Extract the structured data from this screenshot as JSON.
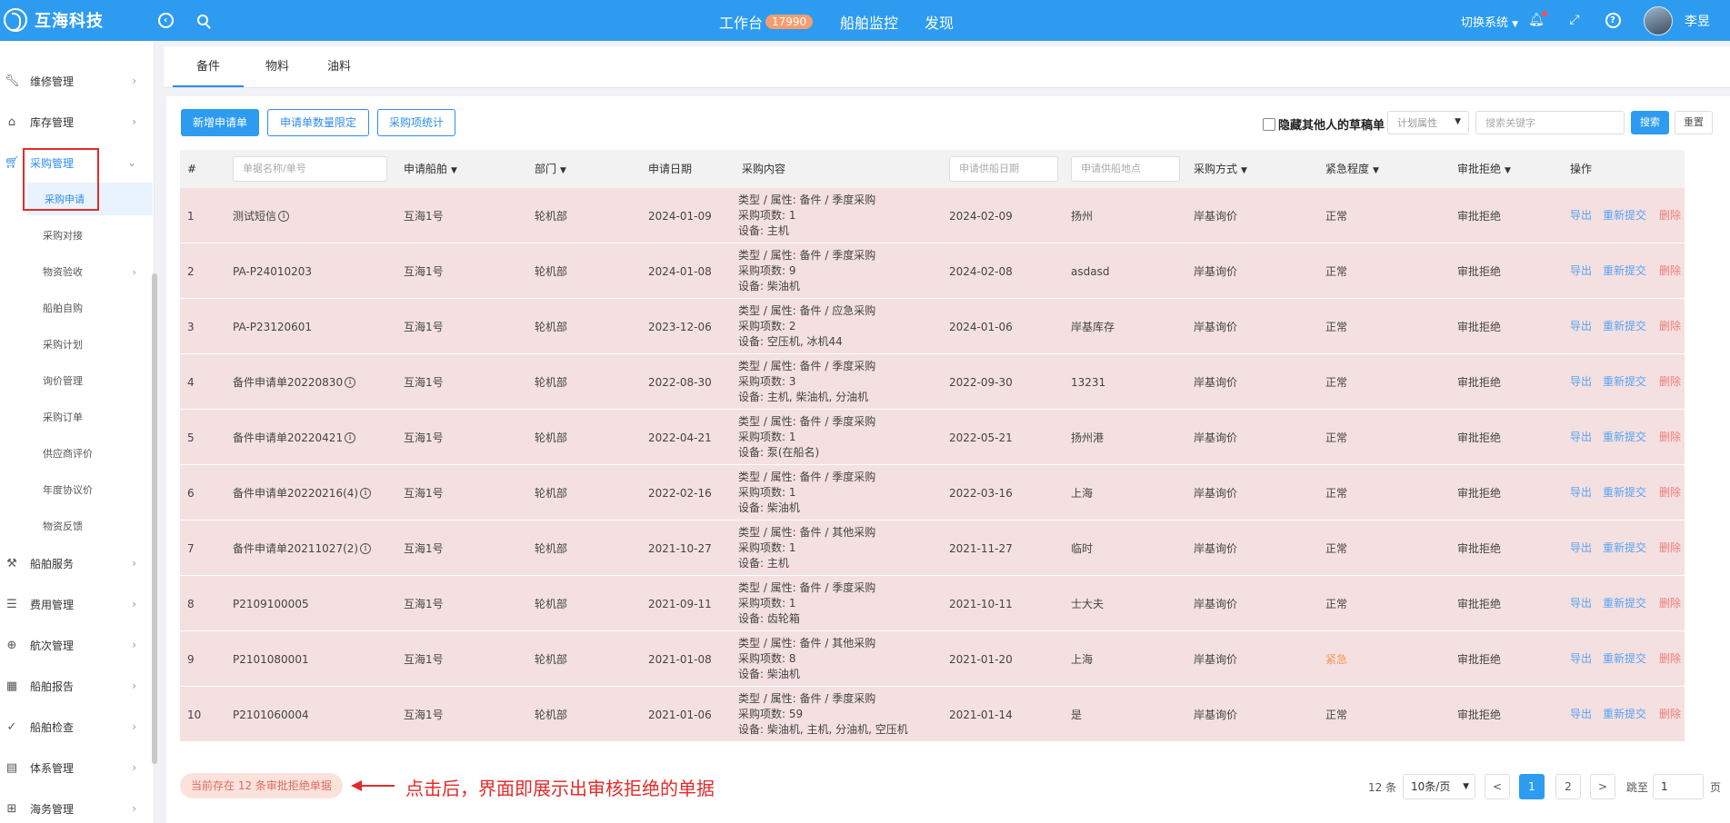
{
  "app": {
    "brand": "互海科技",
    "nav": [
      {
        "label": "工作台",
        "badge": "17990"
      },
      {
        "label": "船舶监控"
      },
      {
        "label": "发现"
      }
    ],
    "switch_system": "切换系统",
    "user": "李昱"
  },
  "sidebar": {
    "items": [
      {
        "label": "维修管理"
      },
      {
        "label": "库存管理"
      },
      {
        "label": "采购管理"
      },
      {
        "label": "船舶服务"
      },
      {
        "label": "费用管理"
      },
      {
        "label": "航次管理"
      },
      {
        "label": "船舶报告"
      },
      {
        "label": "船舶检查"
      },
      {
        "label": "体系管理"
      },
      {
        "label": "海务管理"
      }
    ],
    "sub_items": [
      {
        "label": "采购申请"
      },
      {
        "label": "采购对接"
      },
      {
        "label": "物资验收"
      },
      {
        "label": "船舶自购"
      },
      {
        "label": "采购计划"
      },
      {
        "label": "询价管理"
      },
      {
        "label": "采购订单"
      },
      {
        "label": "供应商评价"
      },
      {
        "label": "年度协议价"
      },
      {
        "label": "物资反馈"
      }
    ]
  },
  "tabs": [
    {
      "label": "备件"
    },
    {
      "label": "物料"
    },
    {
      "label": "油料"
    }
  ],
  "toolbar": {
    "new_button": "新增申请单",
    "limit_button": "申请单数量限定",
    "stats_button": "采购项统计",
    "hide_drafts": "隐藏其他人的草稿单",
    "plan_attr_placeholder": "计划属性",
    "search_placeholder": "搜索关键字",
    "search_button": "搜索",
    "reset_button": "重置"
  },
  "table": {
    "headers": {
      "index": "#",
      "name_placeholder": "单据名称/单号",
      "ship": "申请船舶",
      "dept": "部门",
      "date": "申请日期",
      "content": "采购内容",
      "supply_date_placeholder": "申请供船日期",
      "supply_place_placeholder": "申请供船地点",
      "method": "采购方式",
      "urgency": "紧急程度",
      "status": "审批拒绝",
      "ops": "操作"
    },
    "rows": [
      {
        "idx": "1",
        "name": "测试短信",
        "info": true,
        "ship": "互海1号",
        "dept": "轮机部",
        "date": "2024-01-09",
        "c1": "类型 / 属性:  备件 / 季度采购",
        "c2": "采购项数:  1",
        "c3": "设备:   主机",
        "supply_date": "2024-02-09",
        "place": "扬州",
        "method": "岸基询价",
        "urgency": "正常",
        "status": "审批拒绝"
      },
      {
        "idx": "2",
        "name": "PA-P24010203",
        "info": false,
        "ship": "互海1号",
        "dept": "轮机部",
        "date": "2024-01-08",
        "c1": "类型 / 属性:  备件 / 季度采购",
        "c2": "采购项数:  9",
        "c3": "设备:   柴油机",
        "supply_date": "2024-02-08",
        "place": "asdasd",
        "method": "岸基询价",
        "urgency": "正常",
        "status": "审批拒绝"
      },
      {
        "idx": "3",
        "name": "PA-P23120601",
        "info": false,
        "ship": "互海1号",
        "dept": "轮机部",
        "date": "2023-12-06",
        "c1": "类型 / 属性:  备件 / 应急采购",
        "c2": "采购项数:  2",
        "c3": "设备:   空压机, 冰机44",
        "supply_date": "2024-01-06",
        "place": "岸基库存",
        "method": "岸基询价",
        "urgency": "正常",
        "status": "审批拒绝"
      },
      {
        "idx": "4",
        "name": "备件申请单20220830",
        "info": true,
        "ship": "互海1号",
        "dept": "轮机部",
        "date": "2022-08-30",
        "c1": "类型 / 属性:  备件 / 季度采购",
        "c2": "采购项数:  3",
        "c3": "设备:   主机, 柴油机, 分油机",
        "supply_date": "2022-09-30",
        "place": "13231",
        "method": "岸基询价",
        "urgency": "正常",
        "status": "审批拒绝"
      },
      {
        "idx": "5",
        "name": "备件申请单20220421",
        "info": true,
        "ship": "互海1号",
        "dept": "轮机部",
        "date": "2022-04-21",
        "c1": "类型 / 属性:  备件 / 季度采购",
        "c2": "采购项数:  1",
        "c3": "设备:   泵(在船名)",
        "supply_date": "2022-05-21",
        "place": "扬州港",
        "method": "岸基询价",
        "urgency": "正常",
        "status": "审批拒绝"
      },
      {
        "idx": "6",
        "name": "备件申请单20220216(4)",
        "info": true,
        "ship": "互海1号",
        "dept": "轮机部",
        "date": "2022-02-16",
        "c1": "类型 / 属性:  备件 / 季度采购",
        "c2": "采购项数:  1",
        "c3": "设备:   柴油机",
        "supply_date": "2022-03-16",
        "place": "上海",
        "method": "岸基询价",
        "urgency": "正常",
        "status": "审批拒绝"
      },
      {
        "idx": "7",
        "name": "备件申请单20211027(2)",
        "info": true,
        "ship": "互海1号",
        "dept": "轮机部",
        "date": "2021-10-27",
        "c1": "类型 / 属性:  备件 / 其他采购",
        "c2": "采购项数:  1",
        "c3": "设备:   主机",
        "supply_date": "2021-11-27",
        "place": "临时",
        "method": "岸基询价",
        "urgency": "正常",
        "status": "审批拒绝"
      },
      {
        "idx": "8",
        "name": "P2109100005",
        "info": false,
        "ship": "互海1号",
        "dept": "轮机部",
        "date": "2021-09-11",
        "c1": "类型 / 属性:  备件 / 季度采购",
        "c2": "采购项数:  1",
        "c3": "设备:   齿轮箱",
        "supply_date": "2021-10-11",
        "place": "士大夫",
        "method": "岸基询价",
        "urgency": "正常",
        "status": "审批拒绝"
      },
      {
        "idx": "9",
        "name": "P2101080001",
        "info": false,
        "ship": "互海1号",
        "dept": "轮机部",
        "date": "2021-01-08",
        "c1": "类型 / 属性:  备件 / 其他采购",
        "c2": "采购项数:  8",
        "c3": "设备:   柴油机",
        "supply_date": "2021-01-20",
        "place": "上海",
        "method": "岸基询价",
        "urgency": "紧急",
        "status": "审批拒绝"
      },
      {
        "idx": "10",
        "name": "P2101060004",
        "info": false,
        "ship": "互海1号",
        "dept": "轮机部",
        "date": "2021-01-06",
        "c1": "类型 / 属性:  备件 / 季度采购",
        "c2": "采购项数:  59",
        "c3": "设备:   柴油机, 主机, 分油机, 空压机",
        "supply_date": "2021-01-14",
        "place": "是",
        "method": "岸基询价",
        "urgency": "正常",
        "status": "审批拒绝"
      }
    ],
    "ops": {
      "export": "导出",
      "resubmit": "重新提交",
      "delete": "删除"
    }
  },
  "footer": {
    "notice": "当前存在 12 条审批拒绝单据",
    "annotation": "点击后，界面即展示出审核拒绝的单据",
    "total": "12 条",
    "page_size": "10条/页",
    "prev": "<",
    "pages": [
      "1",
      "2"
    ],
    "next": ">",
    "jump_label": "跳至",
    "jump_value": "1",
    "page_unit": "页"
  },
  "colors": {
    "primary": "#2d9cf0",
    "row_highlight": "#f4e0e1",
    "annotation_red": "#e32b2b"
  }
}
